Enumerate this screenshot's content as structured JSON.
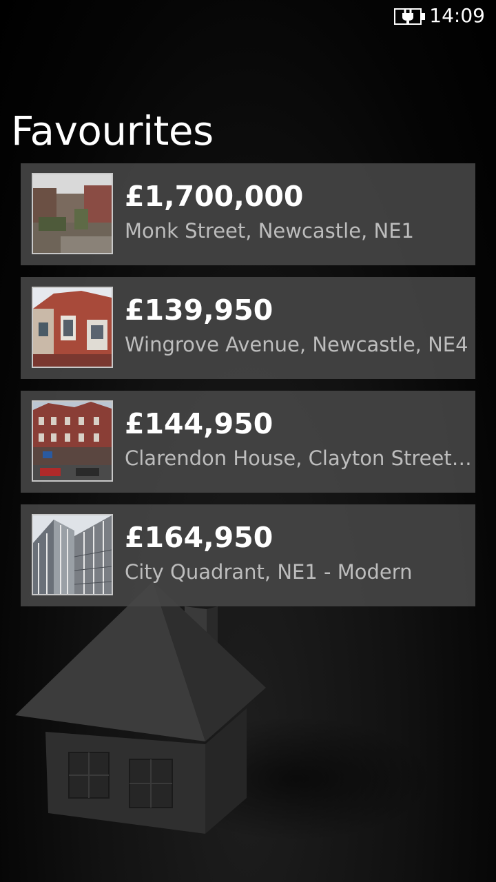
{
  "status_bar": {
    "time": "14:09",
    "battery_icon": "battery-charging-icon"
  },
  "page": {
    "title": "Favourites"
  },
  "favourites": [
    {
      "price": "£1,700,000",
      "address": "Monk Street, Newcastle, NE1",
      "thumbnail": "house-photo-1"
    },
    {
      "price": "£139,950",
      "address": "Wingrove Avenue, Newcastle, NE4",
      "thumbnail": "house-photo-2"
    },
    {
      "price": "£144,950",
      "address": "Clarendon House, Clayton Street, Newcastle",
      "thumbnail": "house-photo-3"
    },
    {
      "price": "£164,950",
      "address": "City Quadrant, NE1 - Modern",
      "thumbnail": "house-photo-4"
    }
  ],
  "colors": {
    "item_background": "#464646",
    "address_text": "#bdbdbd",
    "thumb_border": "#c8c8c8"
  }
}
